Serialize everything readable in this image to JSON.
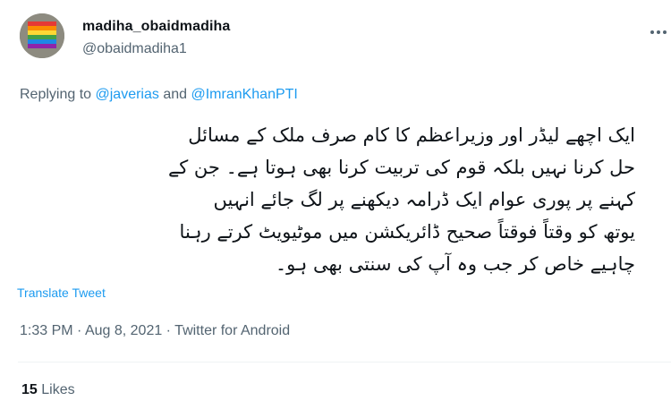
{
  "user": {
    "display_name": "madiha_obaidmadiha",
    "handle": "@obaidmadiha1",
    "avatar_colors": [
      "#e53935",
      "#fb8c00",
      "#fdd835",
      "#43a047",
      "#1e88e5",
      "#8e24aa"
    ]
  },
  "reply": {
    "prefix": "Replying to ",
    "mention_1": "@javerias",
    "and": " and ",
    "mention_2": "@ImranKhanPTI"
  },
  "tweet": {
    "lines": [
      "ایک اچھے لیڈر اور وزیراعظم کا کام صرف ملک کے مسائل",
      "حل کرنا نہیں بلکہ قوم کی تربیت کرنا بھی ہوتا ہے۔ جن کے",
      "کہنے پر پوری عوام ایک ڈرامہ دیکھنے پر لگ جائے انہیں",
      "یوتھ کو وقتاً فوقتاً صحیح ڈائریکشن میں موٹیویٹ کرتے رہنا",
      "چاہیے خاص کر جب وہ آپ کی سنتی بھی ہو۔"
    ],
    "translate_label": "Translate Tweet"
  },
  "meta": {
    "time": "1:33 PM",
    "date": "Aug 8, 2021",
    "separator": " · ",
    "source": "Twitter for Android"
  },
  "stats": {
    "likes_count": "15",
    "likes_label": "Likes"
  },
  "colors": {
    "accent": "#1d9bf0",
    "secondary_text": "#536471",
    "divider": "#eff3f4"
  }
}
